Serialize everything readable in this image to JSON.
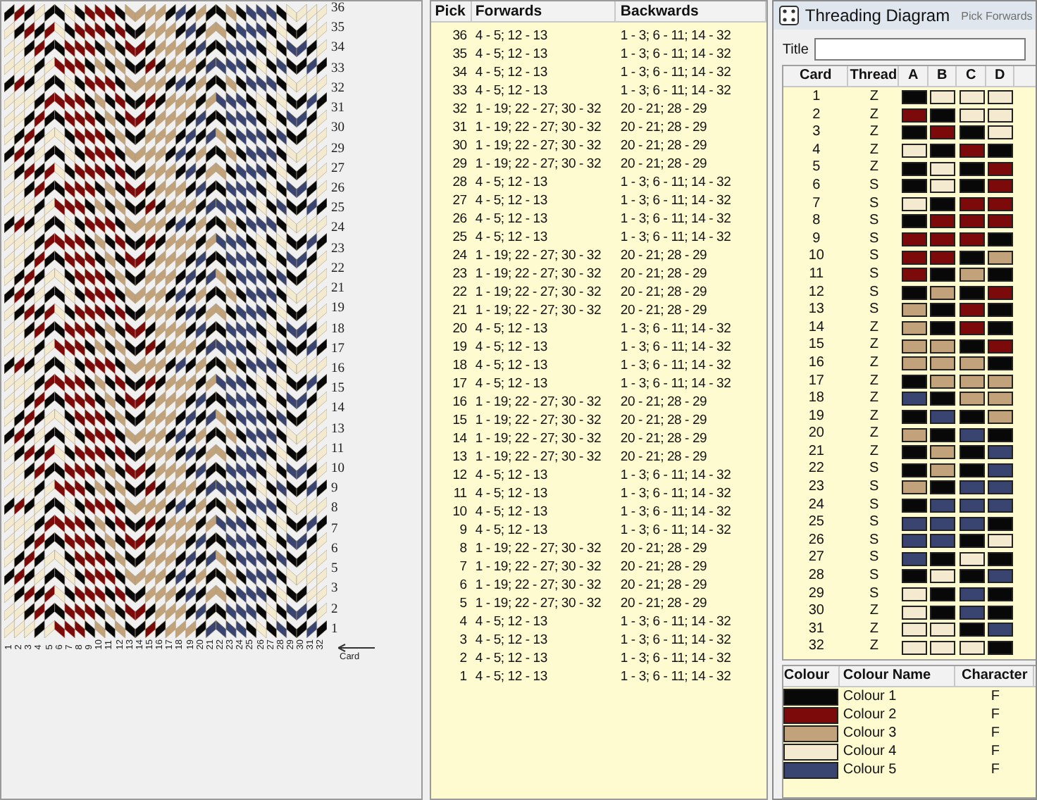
{
  "pattern": {
    "pick_labels": [
      "36",
      "35",
      "34",
      "33",
      "32",
      "31",
      "30",
      "29",
      "27",
      "26",
      "25",
      "24",
      "23",
      "22",
      "21",
      "19",
      "18",
      "17",
      "16",
      "15",
      "14",
      "13",
      "11",
      "10",
      "9",
      "8",
      "7",
      "6",
      "5",
      "3",
      "2",
      "1"
    ],
    "card_numbers": [
      "1",
      "2",
      "3",
      "4",
      "5",
      "6",
      "7",
      "8",
      "9",
      "10",
      "11",
      "12",
      "13",
      "14",
      "15",
      "16",
      "17",
      "18",
      "19",
      "20",
      "21",
      "22",
      "23",
      "24",
      "25",
      "26",
      "27",
      "28",
      "29",
      "30",
      "31",
      "32"
    ],
    "card_label": "Card"
  },
  "pick_table": {
    "columns": [
      "Pick",
      "Forwards",
      "Backwards"
    ],
    "rows": [
      {
        "pick": "36",
        "forwards": "4 - 5; 12 - 13",
        "backwards": "1 - 3; 6 - 11; 14 - 32"
      },
      {
        "pick": "35",
        "forwards": "4 - 5; 12 - 13",
        "backwards": "1 - 3; 6 - 11; 14 - 32"
      },
      {
        "pick": "34",
        "forwards": "4 - 5; 12 - 13",
        "backwards": "1 - 3; 6 - 11; 14 - 32"
      },
      {
        "pick": "33",
        "forwards": "4 - 5; 12 - 13",
        "backwards": "1 - 3; 6 - 11; 14 - 32"
      },
      {
        "pick": "32",
        "forwards": "1 - 19; 22 - 27; 30 - 32",
        "backwards": "20 - 21; 28 - 29"
      },
      {
        "pick": "31",
        "forwards": "1 - 19; 22 - 27; 30 - 32",
        "backwards": "20 - 21; 28 - 29"
      },
      {
        "pick": "30",
        "forwards": "1 - 19; 22 - 27; 30 - 32",
        "backwards": "20 - 21; 28 - 29"
      },
      {
        "pick": "29",
        "forwards": "1 - 19; 22 - 27; 30 - 32",
        "backwards": "20 - 21; 28 - 29"
      },
      {
        "pick": "28",
        "forwards": "4 - 5; 12 - 13",
        "backwards": "1 - 3; 6 - 11; 14 - 32"
      },
      {
        "pick": "27",
        "forwards": "4 - 5; 12 - 13",
        "backwards": "1 - 3; 6 - 11; 14 - 32"
      },
      {
        "pick": "26",
        "forwards": "4 - 5; 12 - 13",
        "backwards": "1 - 3; 6 - 11; 14 - 32"
      },
      {
        "pick": "25",
        "forwards": "4 - 5; 12 - 13",
        "backwards": "1 - 3; 6 - 11; 14 - 32"
      },
      {
        "pick": "24",
        "forwards": "1 - 19; 22 - 27; 30 - 32",
        "backwards": "20 - 21; 28 - 29"
      },
      {
        "pick": "23",
        "forwards": "1 - 19; 22 - 27; 30 - 32",
        "backwards": "20 - 21; 28 - 29"
      },
      {
        "pick": "22",
        "forwards": "1 - 19; 22 - 27; 30 - 32",
        "backwards": "20 - 21; 28 - 29"
      },
      {
        "pick": "21",
        "forwards": "1 - 19; 22 - 27; 30 - 32",
        "backwards": "20 - 21; 28 - 29"
      },
      {
        "pick": "20",
        "forwards": "4 - 5; 12 - 13",
        "backwards": "1 - 3; 6 - 11; 14 - 32"
      },
      {
        "pick": "19",
        "forwards": "4 - 5; 12 - 13",
        "backwards": "1 - 3; 6 - 11; 14 - 32"
      },
      {
        "pick": "18",
        "forwards": "4 - 5; 12 - 13",
        "backwards": "1 - 3; 6 - 11; 14 - 32"
      },
      {
        "pick": "17",
        "forwards": "4 - 5; 12 - 13",
        "backwards": "1 - 3; 6 - 11; 14 - 32"
      },
      {
        "pick": "16",
        "forwards": "1 - 19; 22 - 27; 30 - 32",
        "backwards": "20 - 21; 28 - 29"
      },
      {
        "pick": "15",
        "forwards": "1 - 19; 22 - 27; 30 - 32",
        "backwards": "20 - 21; 28 - 29"
      },
      {
        "pick": "14",
        "forwards": "1 - 19; 22 - 27; 30 - 32",
        "backwards": "20 - 21; 28 - 29"
      },
      {
        "pick": "13",
        "forwards": "1 - 19; 22 - 27; 30 - 32",
        "backwards": "20 - 21; 28 - 29"
      },
      {
        "pick": "12",
        "forwards": "4 - 5; 12 - 13",
        "backwards": "1 - 3; 6 - 11; 14 - 32"
      },
      {
        "pick": "11",
        "forwards": "4 - 5; 12 - 13",
        "backwards": "1 - 3; 6 - 11; 14 - 32"
      },
      {
        "pick": "10",
        "forwards": "4 - 5; 12 - 13",
        "backwards": "1 - 3; 6 - 11; 14 - 32"
      },
      {
        "pick": "9",
        "forwards": "4 - 5; 12 - 13",
        "backwards": "1 - 3; 6 - 11; 14 - 32"
      },
      {
        "pick": "8",
        "forwards": "1 - 19; 22 - 27; 30 - 32",
        "backwards": "20 - 21; 28 - 29"
      },
      {
        "pick": "7",
        "forwards": "1 - 19; 22 - 27; 30 - 32",
        "backwards": "20 - 21; 28 - 29"
      },
      {
        "pick": "6",
        "forwards": "1 - 19; 22 - 27; 30 - 32",
        "backwards": "20 - 21; 28 - 29"
      },
      {
        "pick": "5",
        "forwards": "1 - 19; 22 - 27; 30 - 32",
        "backwards": "20 - 21; 28 - 29"
      },
      {
        "pick": "4",
        "forwards": "4 - 5; 12 - 13",
        "backwards": "1 - 3; 6 - 11; 14 - 32"
      },
      {
        "pick": "3",
        "forwards": "4 - 5; 12 - 13",
        "backwards": "1 - 3; 6 - 11; 14 - 32"
      },
      {
        "pick": "2",
        "forwards": "4 - 5; 12 - 13",
        "backwards": "1 - 3; 6 - 11; 14 - 32"
      },
      {
        "pick": "1",
        "forwards": "4 - 5; 12 - 13",
        "backwards": "1 - 3; 6 - 11; 14 - 32"
      }
    ]
  },
  "window": {
    "title": "Threading Diagram",
    "ghost_text": "Pick Forwards",
    "title_label": "Title",
    "threading": {
      "columns": [
        "Card",
        "Thread",
        "A",
        "B",
        "C",
        "D"
      ],
      "cards": [
        {
          "card": "1",
          "thread": "Z",
          "holes": [
            {
              "color": "#080808"
            },
            {
              "color": "#f3ead0"
            },
            {
              "color": "#f3ead0"
            },
            {
              "color": "#f3ead0"
            }
          ]
        },
        {
          "card": "2",
          "thread": "Z",
          "holes": [
            {
              "color": "#7d0a0a"
            },
            {
              "color": "#080808"
            },
            {
              "color": "#f3ead0"
            },
            {
              "color": "#f3ead0"
            }
          ]
        },
        {
          "card": "3",
          "thread": "Z",
          "holes": [
            {
              "color": "#080808"
            },
            {
              "color": "#7d0a0a"
            },
            {
              "color": "#080808"
            },
            {
              "color": "#f3ead0"
            }
          ]
        },
        {
          "card": "4",
          "thread": "Z",
          "holes": [
            {
              "color": "#f3ead0"
            },
            {
              "color": "#080808"
            },
            {
              "color": "#7d0a0a"
            },
            {
              "color": "#080808"
            }
          ]
        },
        {
          "card": "5",
          "thread": "Z",
          "holes": [
            {
              "color": "#080808"
            },
            {
              "color": "#f3ead0"
            },
            {
              "color": "#080808"
            },
            {
              "color": "#7d0a0a"
            }
          ]
        },
        {
          "card": "6",
          "thread": "S",
          "holes": [
            {
              "color": "#080808"
            },
            {
              "color": "#f3ead0"
            },
            {
              "color": "#080808"
            },
            {
              "color": "#7d0a0a"
            }
          ]
        },
        {
          "card": "7",
          "thread": "S",
          "holes": [
            {
              "color": "#f3ead0"
            },
            {
              "color": "#080808"
            },
            {
              "color": "#7d0a0a"
            },
            {
              "color": "#7d0a0a"
            }
          ]
        },
        {
          "card": "8",
          "thread": "S",
          "holes": [
            {
              "color": "#080808"
            },
            {
              "color": "#7d0a0a"
            },
            {
              "color": "#7d0a0a"
            },
            {
              "color": "#7d0a0a"
            }
          ]
        },
        {
          "card": "9",
          "thread": "S",
          "holes": [
            {
              "color": "#7d0a0a"
            },
            {
              "color": "#7d0a0a"
            },
            {
              "color": "#7d0a0a"
            },
            {
              "color": "#080808"
            }
          ]
        },
        {
          "card": "10",
          "thread": "S",
          "holes": [
            {
              "color": "#7d0a0a"
            },
            {
              "color": "#7d0a0a"
            },
            {
              "color": "#080808"
            },
            {
              "color": "#c1a27a"
            }
          ]
        },
        {
          "card": "11",
          "thread": "S",
          "holes": [
            {
              "color": "#7d0a0a"
            },
            {
              "color": "#080808"
            },
            {
              "color": "#c1a27a"
            },
            {
              "color": "#080808"
            }
          ]
        },
        {
          "card": "12",
          "thread": "S",
          "holes": [
            {
              "color": "#080808"
            },
            {
              "color": "#c1a27a"
            },
            {
              "color": "#080808"
            },
            {
              "color": "#7d0a0a"
            }
          ]
        },
        {
          "card": "13",
          "thread": "S",
          "holes": [
            {
              "color": "#c1a27a"
            },
            {
              "color": "#080808"
            },
            {
              "color": "#7d0a0a"
            },
            {
              "color": "#080808"
            }
          ]
        },
        {
          "card": "14",
          "thread": "Z",
          "holes": [
            {
              "color": "#c1a27a"
            },
            {
              "color": "#080808"
            },
            {
              "color": "#7d0a0a"
            },
            {
              "color": "#080808"
            }
          ]
        },
        {
          "card": "15",
          "thread": "Z",
          "holes": [
            {
              "color": "#c1a27a"
            },
            {
              "color": "#c1a27a"
            },
            {
              "color": "#080808"
            },
            {
              "color": "#7d0a0a"
            }
          ]
        },
        {
          "card": "16",
          "thread": "Z",
          "holes": [
            {
              "color": "#c1a27a"
            },
            {
              "color": "#c1a27a"
            },
            {
              "color": "#c1a27a"
            },
            {
              "color": "#080808"
            }
          ]
        },
        {
          "card": "17",
          "thread": "Z",
          "holes": [
            {
              "color": "#080808"
            },
            {
              "color": "#c1a27a"
            },
            {
              "color": "#c1a27a"
            },
            {
              "color": "#c1a27a"
            }
          ]
        },
        {
          "card": "18",
          "thread": "Z",
          "holes": [
            {
              "color": "#3a4470"
            },
            {
              "color": "#080808"
            },
            {
              "color": "#c1a27a"
            },
            {
              "color": "#c1a27a"
            }
          ]
        },
        {
          "card": "19",
          "thread": "Z",
          "holes": [
            {
              "color": "#080808"
            },
            {
              "color": "#3a4470"
            },
            {
              "color": "#080808"
            },
            {
              "color": "#c1a27a"
            }
          ]
        },
        {
          "card": "20",
          "thread": "Z",
          "holes": [
            {
              "color": "#c1a27a"
            },
            {
              "color": "#080808"
            },
            {
              "color": "#3a4470"
            },
            {
              "color": "#080808"
            }
          ]
        },
        {
          "card": "21",
          "thread": "Z",
          "holes": [
            {
              "color": "#080808"
            },
            {
              "color": "#c1a27a"
            },
            {
              "color": "#080808"
            },
            {
              "color": "#3a4470"
            }
          ]
        },
        {
          "card": "22",
          "thread": "S",
          "holes": [
            {
              "color": "#080808"
            },
            {
              "color": "#c1a27a"
            },
            {
              "color": "#080808"
            },
            {
              "color": "#3a4470"
            }
          ]
        },
        {
          "card": "23",
          "thread": "S",
          "holes": [
            {
              "color": "#c1a27a"
            },
            {
              "color": "#080808"
            },
            {
              "color": "#3a4470"
            },
            {
              "color": "#3a4470"
            }
          ]
        },
        {
          "card": "24",
          "thread": "S",
          "holes": [
            {
              "color": "#080808"
            },
            {
              "color": "#3a4470"
            },
            {
              "color": "#3a4470"
            },
            {
              "color": "#3a4470"
            }
          ]
        },
        {
          "card": "25",
          "thread": "S",
          "holes": [
            {
              "color": "#3a4470"
            },
            {
              "color": "#3a4470"
            },
            {
              "color": "#3a4470"
            },
            {
              "color": "#080808"
            }
          ]
        },
        {
          "card": "26",
          "thread": "S",
          "holes": [
            {
              "color": "#3a4470"
            },
            {
              "color": "#3a4470"
            },
            {
              "color": "#080808"
            },
            {
              "color": "#f3ead0"
            }
          ]
        },
        {
          "card": "27",
          "thread": "S",
          "holes": [
            {
              "color": "#3a4470"
            },
            {
              "color": "#080808"
            },
            {
              "color": "#f3ead0"
            },
            {
              "color": "#080808"
            }
          ]
        },
        {
          "card": "28",
          "thread": "S",
          "holes": [
            {
              "color": "#080808"
            },
            {
              "color": "#f3ead0"
            },
            {
              "color": "#080808"
            },
            {
              "color": "#3a4470"
            }
          ]
        },
        {
          "card": "29",
          "thread": "S",
          "holes": [
            {
              "color": "#f3ead0"
            },
            {
              "color": "#080808"
            },
            {
              "color": "#3a4470"
            },
            {
              "color": "#080808"
            }
          ]
        },
        {
          "card": "30",
          "thread": "Z",
          "holes": [
            {
              "color": "#f3ead0"
            },
            {
              "color": "#080808"
            },
            {
              "color": "#3a4470"
            },
            {
              "color": "#080808"
            }
          ]
        },
        {
          "card": "31",
          "thread": "Z",
          "holes": [
            {
              "color": "#f3ead0"
            },
            {
              "color": "#f3ead0"
            },
            {
              "color": "#080808"
            },
            {
              "color": "#3a4470"
            }
          ]
        },
        {
          "card": "32",
          "thread": "Z",
          "holes": [
            {
              "color": "#f3ead0"
            },
            {
              "color": "#f3ead0"
            },
            {
              "color": "#f3ead0"
            },
            {
              "color": "#080808"
            }
          ]
        }
      ]
    },
    "colours": {
      "columns": [
        "Colour",
        "Colour Name",
        "Character"
      ],
      "rows": [
        {
          "name": "Colour 1",
          "character": "F",
          "color": "#080808"
        },
        {
          "name": "Colour 2",
          "character": "F",
          "color": "#7d0a0a"
        },
        {
          "name": "Colour 3",
          "character": "F",
          "color": "#c1a27a"
        },
        {
          "name": "Colour 4",
          "character": "F",
          "color": "#f3ead0"
        },
        {
          "name": "Colour 5",
          "character": "F",
          "color": "#3a4470"
        }
      ]
    }
  }
}
